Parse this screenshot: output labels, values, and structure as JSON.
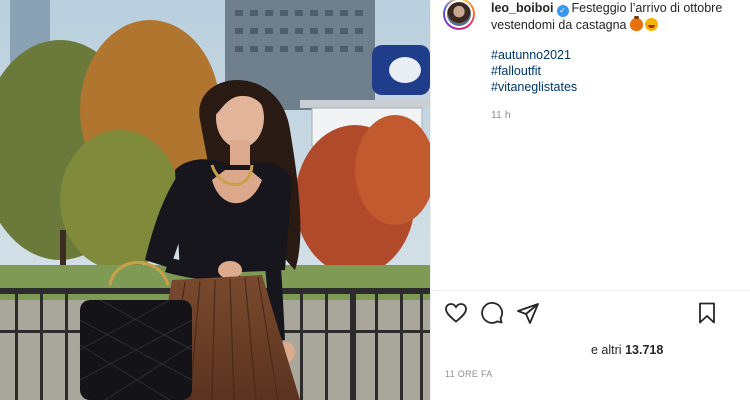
{
  "post": {
    "username": "leo_boiboi",
    "caption": "Festeggio l’arrivo di ottobre vestendomi da castagna",
    "emojis": [
      "chestnut-emoji",
      "smiling-face-hearts-emoji"
    ],
    "hashtags": [
      "#autunno2021",
      "#falloutfit",
      "#vitaneglistates"
    ],
    "time_ago": "11 h"
  },
  "likes": {
    "prefix": "e altri",
    "count": "13.718"
  },
  "date": "11 ORE FA",
  "icons": {
    "like": "heart-icon",
    "comment": "comment-icon",
    "share": "paper-plane-icon",
    "save": "bookmark-icon",
    "verified": "verified-badge-icon"
  },
  "colors": {
    "hashtag": "#00376b",
    "verified": "#3897f0",
    "muted": "#8e8e8e"
  }
}
